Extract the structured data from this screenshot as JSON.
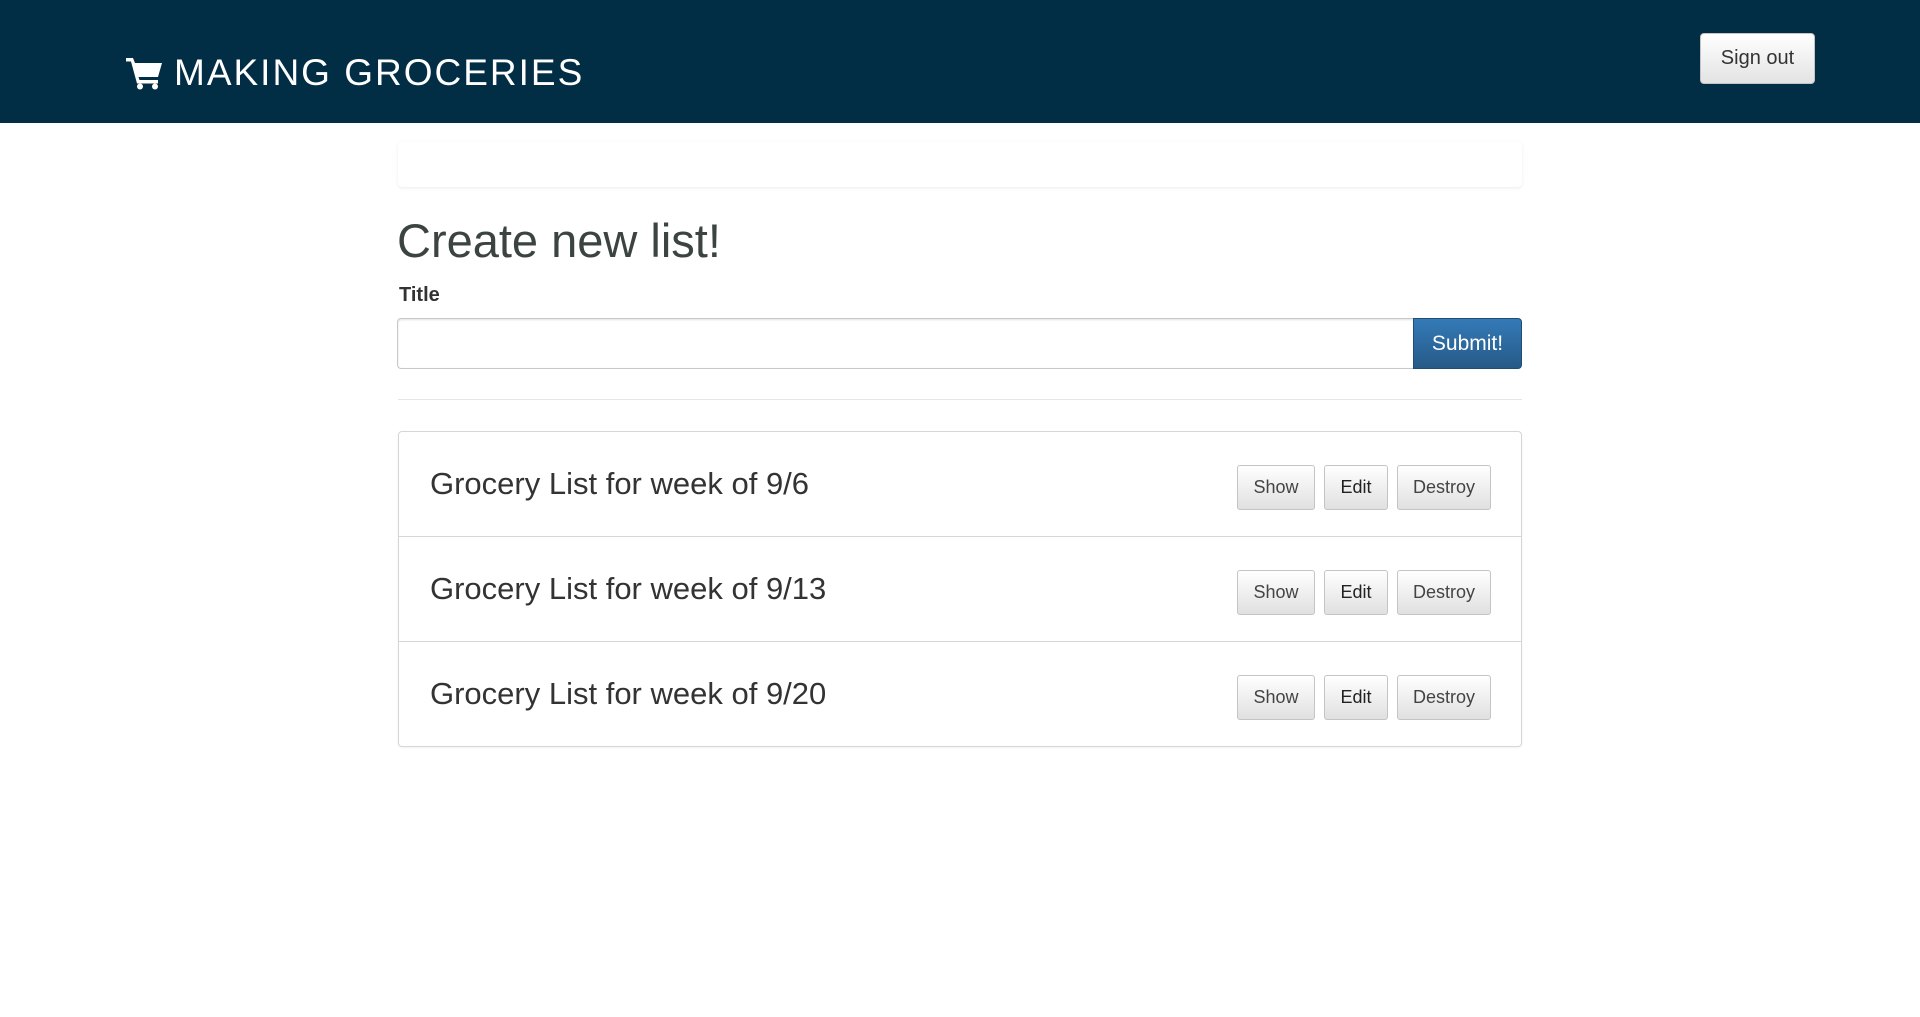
{
  "navbar": {
    "brand": "MAKING GROCERIES",
    "brand_icon": "shopping-cart-icon",
    "background_color": "#012d45",
    "sign_out_label": "Sign out"
  },
  "main": {
    "heading": "Create new list!",
    "form": {
      "title_label": "Title",
      "title_value": "",
      "title_placeholder": "",
      "submit_label": "Submit!"
    },
    "lists": [
      {
        "title": "Grocery List for week of 9/6",
        "show_label": "Show",
        "edit_label": "Edit",
        "destroy_label": "Destroy"
      },
      {
        "title": "Grocery List for week of 9/13",
        "show_label": "Show",
        "edit_label": "Edit",
        "destroy_label": "Destroy"
      },
      {
        "title": "Grocery List for week of 9/20",
        "show_label": "Show",
        "edit_label": "Edit",
        "destroy_label": "Destroy"
      }
    ]
  },
  "colors": {
    "primary_button": "#2d6da3",
    "heading_text": "#3b4440"
  }
}
